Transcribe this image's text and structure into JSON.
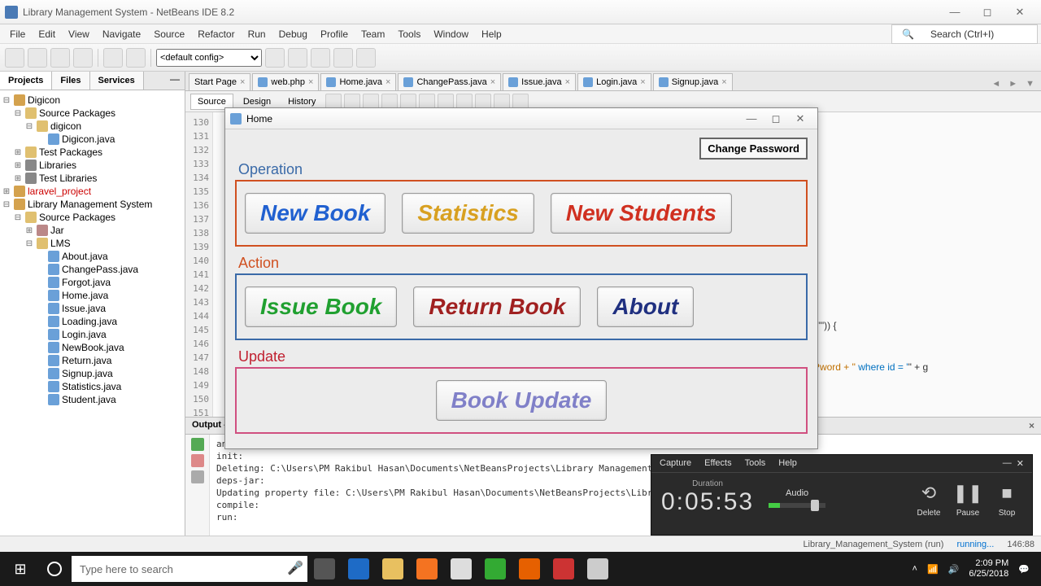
{
  "window": {
    "title": "Library Management System - NetBeans IDE 8.2"
  },
  "menus": [
    "File",
    "Edit",
    "View",
    "Navigate",
    "Source",
    "Refactor",
    "Run",
    "Debug",
    "Profile",
    "Team",
    "Tools",
    "Window",
    "Help"
  ],
  "search_placeholder": "Search (Ctrl+I)",
  "toolbar_config": "<default config>",
  "left_tabs": {
    "projects": "Projects",
    "files": "Files",
    "services": "Services"
  },
  "tree": {
    "digicon": "Digicon",
    "src_pkg": "Source Packages",
    "digicon_pkg": "digicon",
    "digicon_java": "Digicon.java",
    "test_pkg": "Test Packages",
    "libraries": "Libraries",
    "test_lib": "Test Libraries",
    "laravel": "laravel_project",
    "lms": "Library Management System",
    "jar": "Jar",
    "lms_pkg": "LMS",
    "files": [
      "About.java",
      "ChangePass.java",
      "Forgot.java",
      "Home.java",
      "Issue.java",
      "Loading.java",
      "Login.java",
      "NewBook.java",
      "Return.java",
      "Signup.java",
      "Statistics.java",
      "Student.java"
    ]
  },
  "editor_tabs": [
    "Start Page",
    "web.php",
    "Home.java",
    "ChangePass.java",
    "Issue.java",
    "Login.java",
    "Signup.java"
  ],
  "editor_sub": {
    "source": "Source",
    "design": "Design",
    "history": "History"
  },
  "line_start": 130,
  "line_end": 151,
  "code_frag1": "ls(\"\")) {",
  "code_frag2_a": "\" + Pword + \"",
  "code_frag2_b": " where id = '",
  "code_frag2_c": "\" + g",
  "output": {
    "title": "Output - Library_Management_System (run)",
    "lines": [
      "ant -f \"C:\\\\Users\\\\PM Rakibul Hasan",
      "init:",
      "Deleting: C:\\Users\\PM Rakibul Hasan\\Documents\\NetBeansProjects\\Library Management System 2\\build\\built-jar.properti",
      "deps-jar:",
      "Updating property file: C:\\Users\\PM Rakibul Hasan\\Documents\\NetBeansProjects\\Library Management System 2\\build\\buil",
      "compile:",
      "run:"
    ],
    "tab": "Output"
  },
  "status": {
    "proj": "Library_Management_System (run)",
    "state": "running...",
    "time": "146:88"
  },
  "home": {
    "title": "Home",
    "change_pwd": "Change Password",
    "op_label": "Operation",
    "ac_label": "Action",
    "up_label": "Update",
    "btn_newbook": "New Book",
    "btn_stats": "Statistics",
    "btn_newstud": "New Students",
    "btn_issue": "Issue Book",
    "btn_return": "Return Book",
    "btn_about": "About",
    "btn_update": "Book Update"
  },
  "capture": {
    "menu": [
      "Capture",
      "Effects",
      "Tools",
      "Help"
    ],
    "duration_lbl": "Duration",
    "duration": "0:05:53",
    "audio_lbl": "Audio",
    "delete": "Delete",
    "pause": "Pause",
    "stop": "Stop"
  },
  "taskbar": {
    "search": "Type here to search",
    "time": "2:09 PM",
    "date": "6/25/2018"
  }
}
